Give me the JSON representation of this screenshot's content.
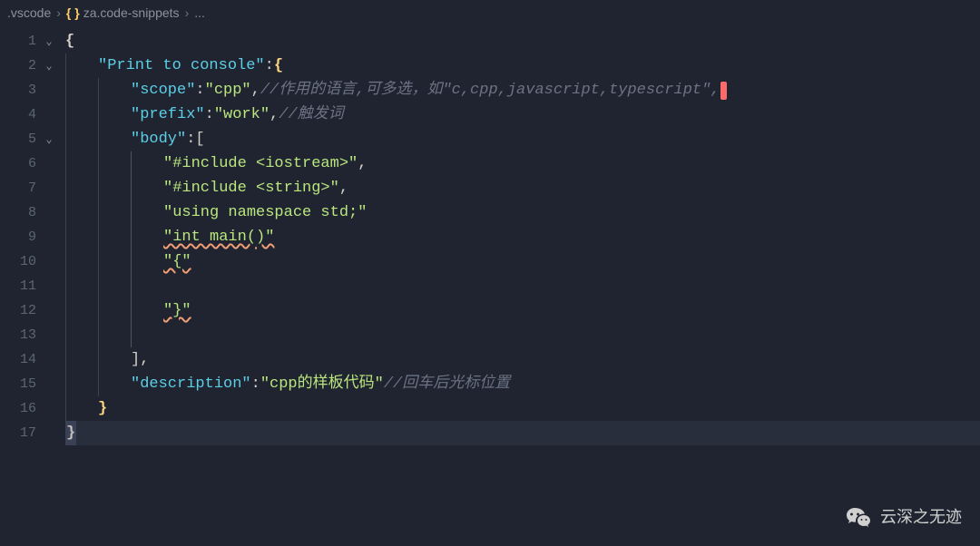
{
  "breadcrumb": {
    "folder": ".vscode",
    "file": "za.code-snippets",
    "trail": "..."
  },
  "lines": {
    "n1": "1",
    "n2": "2",
    "n3": "3",
    "n4": "4",
    "n5": "5",
    "n6": "6",
    "n7": "7",
    "n8": "8",
    "n9": "9",
    "n10": "10",
    "n11": "11",
    "n12": "12",
    "n13": "13",
    "n14": "14",
    "n15": "15",
    "n16": "16",
    "n17": "17"
  },
  "code": {
    "brace_open": "{",
    "brace_close": "}",
    "bracket_open": "[",
    "bracket_close": "]",
    "comma": ",",
    "colon": ":",
    "quote": "\"",
    "snippet_name": "\"Print to console\"",
    "scope_key": "\"scope\"",
    "scope_val": "\"cpp\"",
    "scope_comment": "//作用的语言,可多选，如\"c,cpp,javascript,typescript\",",
    "prefix_key": "\"prefix\"",
    "prefix_val": "\"work\"",
    "prefix_comment": "//触发词",
    "body_key": "\"body\"",
    "body_l1": "\"#include <iostream>\"",
    "body_l2": "\"#include <string>\"",
    "body_l3": "\"using namespace std;\"",
    "body_l4": "\"int main()\"",
    "body_l5": "\"{\"",
    "body_l6": "\"}\"",
    "desc_key": "\"description\"",
    "desc_val": "\"cpp的样板代码\"",
    "desc_comment": "//回车后光标位置"
  },
  "watermark": "云深之无迹"
}
